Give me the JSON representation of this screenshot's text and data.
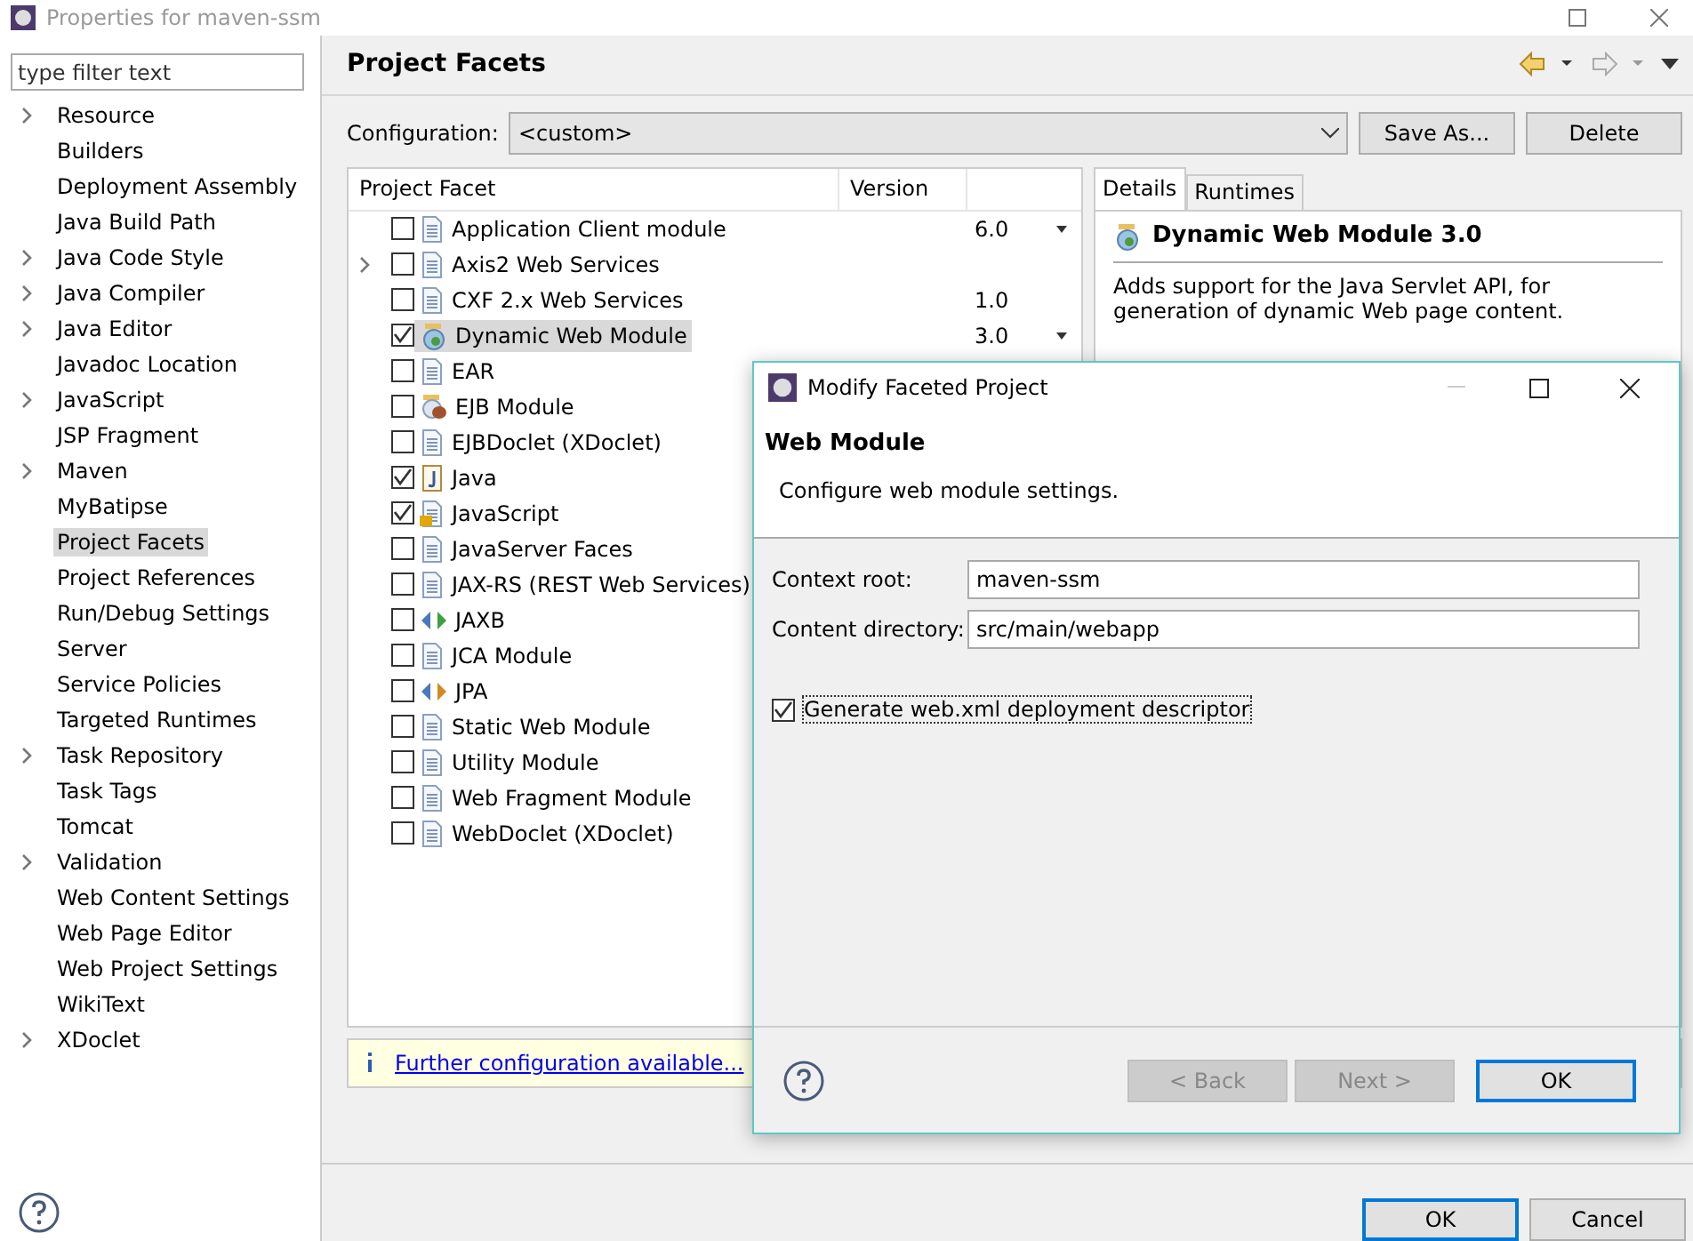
{
  "window": {
    "title": "Properties for maven-ssm"
  },
  "filter": {
    "placeholder": "type filter text"
  },
  "sidebar": {
    "items": [
      {
        "label": "Resource",
        "expandable": true,
        "selected": false
      },
      {
        "label": "Builders",
        "expandable": false,
        "selected": false
      },
      {
        "label": "Deployment Assembly",
        "expandable": false,
        "selected": false
      },
      {
        "label": "Java Build Path",
        "expandable": false,
        "selected": false
      },
      {
        "label": "Java Code Style",
        "expandable": true,
        "selected": false
      },
      {
        "label": "Java Compiler",
        "expandable": true,
        "selected": false
      },
      {
        "label": "Java Editor",
        "expandable": true,
        "selected": false
      },
      {
        "label": "Javadoc Location",
        "expandable": false,
        "selected": false
      },
      {
        "label": "JavaScript",
        "expandable": true,
        "selected": false
      },
      {
        "label": "JSP Fragment",
        "expandable": false,
        "selected": false
      },
      {
        "label": "Maven",
        "expandable": true,
        "selected": false
      },
      {
        "label": "MyBatipse",
        "expandable": false,
        "selected": false
      },
      {
        "label": "Project Facets",
        "expandable": false,
        "selected": true
      },
      {
        "label": "Project References",
        "expandable": false,
        "selected": false
      },
      {
        "label": "Run/Debug Settings",
        "expandable": false,
        "selected": false
      },
      {
        "label": "Server",
        "expandable": false,
        "selected": false
      },
      {
        "label": "Service Policies",
        "expandable": false,
        "selected": false
      },
      {
        "label": "Targeted Runtimes",
        "expandable": false,
        "selected": false
      },
      {
        "label": "Task Repository",
        "expandable": true,
        "selected": false
      },
      {
        "label": "Task Tags",
        "expandable": false,
        "selected": false
      },
      {
        "label": "Tomcat",
        "expandable": false,
        "selected": false
      },
      {
        "label": "Validation",
        "expandable": true,
        "selected": false
      },
      {
        "label": "Web Content Settings",
        "expandable": false,
        "selected": false
      },
      {
        "label": "Web Page Editor",
        "expandable": false,
        "selected": false
      },
      {
        "label": "Web Project Settings",
        "expandable": false,
        "selected": false
      },
      {
        "label": "WikiText",
        "expandable": false,
        "selected": false
      },
      {
        "label": "XDoclet",
        "expandable": true,
        "selected": false
      }
    ]
  },
  "page": {
    "title": "Project Facets",
    "configuration_label": "Configuration:",
    "configuration_value": "<custom>",
    "buttons": [
      "Save As...",
      "Delete"
    ]
  },
  "table": {
    "columns": [
      "Project Facet",
      "Version"
    ],
    "rows": [
      {
        "name": "Application Client module",
        "kind": "doc",
        "checked": false,
        "expandable": false,
        "selected": false,
        "version": "6.0",
        "dropdown": true
      },
      {
        "name": "Axis2 Web Services",
        "kind": "doc",
        "checked": false,
        "expandable": true,
        "selected": false
      },
      {
        "name": "CXF 2.x Web Services",
        "kind": "doc",
        "checked": false,
        "expandable": false,
        "selected": false,
        "version": "1.0",
        "dropdown": false
      },
      {
        "name": "Dynamic Web Module",
        "kind": "globe",
        "checked": true,
        "expandable": false,
        "selected": true,
        "version": "3.0",
        "dropdown": true
      },
      {
        "name": "EAR",
        "kind": "doc",
        "checked": false,
        "expandable": false,
        "selected": false
      },
      {
        "name": "EJB Module",
        "kind": "bean",
        "checked": false,
        "expandable": false,
        "selected": false
      },
      {
        "name": "EJBDoclet (XDoclet)",
        "kind": "doc",
        "checked": false,
        "expandable": false,
        "selected": false
      },
      {
        "name": "Java",
        "kind": "java",
        "checked": true,
        "expandable": false,
        "selected": false
      },
      {
        "name": "JavaScript",
        "kind": "locked",
        "checked": true,
        "expandable": false,
        "selected": false
      },
      {
        "name": "JavaServer Faces",
        "kind": "doc",
        "checked": false,
        "expandable": false,
        "selected": false
      },
      {
        "name": "JAX-RS (REST Web Services)",
        "kind": "doc",
        "checked": false,
        "expandable": false,
        "selected": false
      },
      {
        "name": "JAXB",
        "kind": "binding",
        "checked": false,
        "expandable": false,
        "selected": false
      },
      {
        "name": "JCA Module",
        "kind": "doc",
        "checked": false,
        "expandable": false,
        "selected": false
      },
      {
        "name": "JPA",
        "kind": "persistence",
        "checked": false,
        "expandable": false,
        "selected": false
      },
      {
        "name": "Static Web Module",
        "kind": "doc",
        "checked": false,
        "expandable": false,
        "selected": false
      },
      {
        "name": "Utility Module",
        "kind": "doc",
        "checked": false,
        "expandable": false,
        "selected": false
      },
      {
        "name": "Web Fragment Module",
        "kind": "doc",
        "checked": false,
        "expandable": false,
        "selected": false
      },
      {
        "name": "WebDoclet (XDoclet)",
        "kind": "doc",
        "checked": false,
        "expandable": false,
        "selected": false
      }
    ]
  },
  "details": {
    "tabs": [
      {
        "label": "Details",
        "selected": true
      },
      {
        "label": "Runtimes",
        "selected": false
      }
    ],
    "heading": "Dynamic Web Module 3.0",
    "text": "Adds support for the Java Servlet API, for generation of dynamic Web page content."
  },
  "info_link": "Further configuration available...",
  "footer_buttons": [
    "OK",
    "Cancel"
  ],
  "dialog": {
    "title": "Modify Faceted Project",
    "heading": "Web Module",
    "description": "Configure web module settings.",
    "fields": [
      {
        "label": "Context root:",
        "value": "maven-ssm"
      },
      {
        "label": "Content directory:",
        "value": "src/main/webapp"
      }
    ],
    "checkbox": {
      "label": "Generate web.xml deployment descriptor",
      "checked": true
    },
    "buttons": [
      {
        "label": "< Back",
        "disabled": true,
        "default": false
      },
      {
        "label": "Next >",
        "disabled": true,
        "default": false
      },
      {
        "label": "OK",
        "disabled": false,
        "default": true
      }
    ]
  }
}
